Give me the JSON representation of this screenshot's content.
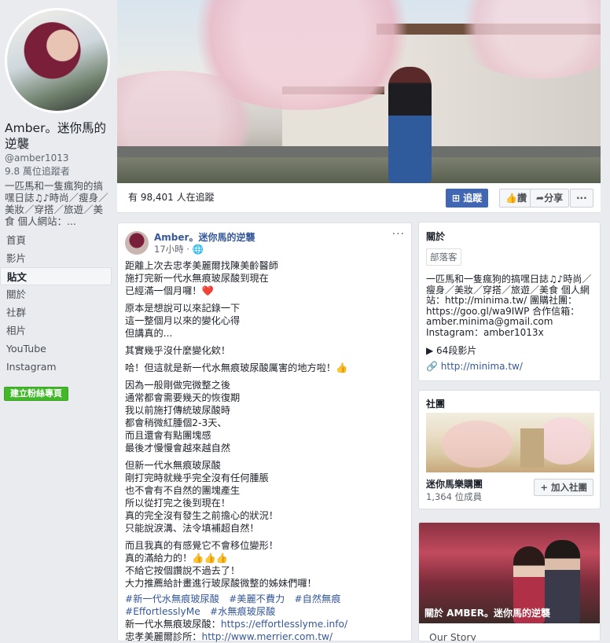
{
  "profile": {
    "name": "Amber。迷你馬的逆襲",
    "handle": "@amber1013",
    "followers": "9.8 萬位追蹤者",
    "tagline": "一匹馬和一隻瘋狗的搞嘿日誌♫♪時尚／瘦身／美妝／穿搭／旅遊／美食 個人網站：..."
  },
  "nav": [
    "首頁",
    "影片",
    "貼文",
    "關於",
    "社群",
    "相片",
    "YouTube",
    "Instagram"
  ],
  "create_page": "建立粉絲專頁",
  "header": {
    "following_text": "有 98,401 人在追蹤",
    "follow_button": "追蹤",
    "like_button": "讚",
    "share_button": "分享",
    "more_button": "···"
  },
  "post": {
    "author": "Amber。迷你馬的逆襲",
    "time": "17小時 · ",
    "more": "···",
    "paragraphs": [
      "距離上次去忠孝美麗爾找陳美齡醫師\n施打完新一代水無痕玻尿酸到現在\n已經滿一個月囉！❤️",
      "原本是想說可以來記錄一下\n這一整個月以來的變化心得\n但講真的...",
      "其實幾乎沒什麼變化欸！",
      "哈！但這就是新一代水無痕玻尿酸厲害的地方啦！👍",
      "因為一般剛做完微整之後\n通常都會需要幾天的恢復期\n我以前施打傳統玻尿酸時\n都會稍微紅腫個2-3天、\n而且還會有點團塊感\n最後才慢慢會越來越自然",
      "但新一代水無痕玻尿酸\n剛打完時就幾乎完全沒有任何腫脹\n也不會有不自然的團塊產生\n所以從打完之後到現在！\n真的完全沒有發生之前擔心的狀況！\n只能說淚溝、法令填補超自然！",
      "而且我真的有感覺它不會移位變形！\n真的滿給力的！👍👍👍\n不給它按個讚說不過去了！\n大力推薦給計畫進行玻尿酸微整的姊妹們囉！"
    ],
    "hashtags1": "#新一代水無痕玻尿酸　#美麗不費力　#自然無痕",
    "hashtags2": "#EffortlesslyMe　#水無痕玻尿酸",
    "link1_label": "新一代水無痕玻尿酸：",
    "link1": "https://effortlesslyme.info/",
    "link2_label": "忠孝美麗爾診所：",
    "link2": "http://www.merrier.com.tw/"
  },
  "about": {
    "heading": "關於",
    "category": "部落客",
    "text": "一匹馬和一隻瘋狗的搞嘿日誌♫♪時尚／瘦身／美妝／穿搭／旅遊／美食 個人網站：http://minima.tw/ 團購社團：https://goo.gl/wa9IWP 合作信箱：amber.minima@gmail.com Instagram：amber1013x",
    "videos": "64段影片",
    "website": "http://minima.tw/"
  },
  "groups": {
    "heading": "社團",
    "name": "迷你馬樂購團",
    "members": "1,364 位成員",
    "join": "+ 加入社團"
  },
  "story": {
    "overlay": "關於 AMBER。迷你馬的逆襲",
    "title": "Our Story"
  }
}
